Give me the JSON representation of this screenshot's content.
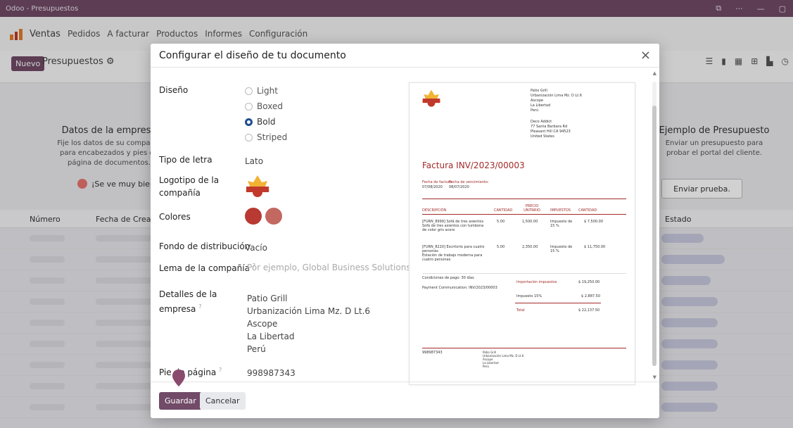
{
  "window": {
    "title": "Odoo - Presupuestos"
  },
  "nav": {
    "app": "Ventas",
    "items": [
      "Pedidos",
      "A facturar",
      "Productos",
      "Informes",
      "Configuración"
    ]
  },
  "cp": {
    "new_label": "Nuevo",
    "title": "Presupuestos"
  },
  "banner": {
    "left_title": "Datos de la empresa",
    "left_text": "Fije los datos de su compañía para encabezados y pies de página de documentos.",
    "left_done": "¡Se ve muy bien!",
    "right_title": "Ejemplo de Presupuesto",
    "right_text": "Enviar un presupuesto para probar el portal del cliente.",
    "right_button": "Enviar prueba."
  },
  "list": {
    "columns": [
      "Número",
      "Fecha de Creación",
      "Estado"
    ]
  },
  "modal": {
    "title": "Configurar el diseño de tu documento",
    "close": "×",
    "labels": {
      "diseno": "Diseño",
      "tipo_letra": "Tipo de letra",
      "logo_1": "Logotipo de la",
      "logo_2": "compañía",
      "colores": "Colores",
      "fondo": "Fondo de distribución",
      "lema": "Lema de la compañía",
      "detalles_1": "Detalles de la",
      "detalles_2": "empresa",
      "pie": "Pie de página",
      "q": "?"
    },
    "layouts": [
      {
        "label": "Light",
        "selected": false
      },
      {
        "label": "Boxed",
        "selected": false
      },
      {
        "label": "Bold",
        "selected": true
      },
      {
        "label": "Striped",
        "selected": false
      }
    ],
    "font": "Lato",
    "colors": [
      "#b83a32",
      "#c36860"
    ],
    "background": "Vacío",
    "tagline_placeholder": "Por ejemplo, Global Business Solutions",
    "company_details": [
      "Patio Grill",
      "Urbanización Lima Mz. D Lt.6",
      "Ascope",
      "La Libertad",
      "Perú"
    ],
    "footer_value": "998987343",
    "buttons": {
      "save": "Guardar",
      "cancel": "Cancelar"
    }
  },
  "preview": {
    "company_address": [
      "Patio Grill",
      "Urbanización Lima Mz. D Lt.6",
      "Ascope",
      "La Libertad",
      "Perú"
    ],
    "customer_address": [
      "Deco Addict",
      "77 Santa Barbara Rd",
      "Pleasant Hill CA 94523",
      "United States"
    ],
    "invoice_title": "Factura INV/2023/00003",
    "date_label": "Fecha de factura:",
    "date_value": "07/08/2020",
    "due_label": "Fecha de vencimiento:",
    "due_value": "08/07/2020",
    "headers": [
      "DESCRIPCIÓN",
      "CANTIDAD",
      "PRECIO UNITARIO",
      "IMPUESTOS",
      "CANTIDAD"
    ],
    "rows": [
      {
        "desc1": "[FURN_8999] Sofá de tres asientos",
        "desc2": "Sofá de tres asientos con tumbona",
        "desc3": "de color gris acero",
        "qty": "5.00",
        "price": "1,500.00",
        "tax": "Impuesto de 15 %",
        "amount": "$ 7,500.00"
      },
      {
        "desc1": "[FURN_8220] Escritorio para cuatro",
        "desc2": "personas",
        "desc3": "Estación de trabajo moderna para cuatro personas",
        "qty": "5.00",
        "price": "2,350.00",
        "tax": "Impuesto de 15 %",
        "amount": "$ 11,750.00"
      }
    ],
    "terms": "Condiciones de pago: 30 días",
    "payment_comm": "Payment Communication: INV/2023/00003",
    "untaxed_label": "Importación impuestos",
    "untaxed_value": "$ 19,250.00",
    "tax_label": "Impuesto 15%",
    "tax_value": "$ 2,887.50",
    "total_label": "Total",
    "total_value": "$ 22,137.50",
    "footer_phone": "998987343"
  }
}
